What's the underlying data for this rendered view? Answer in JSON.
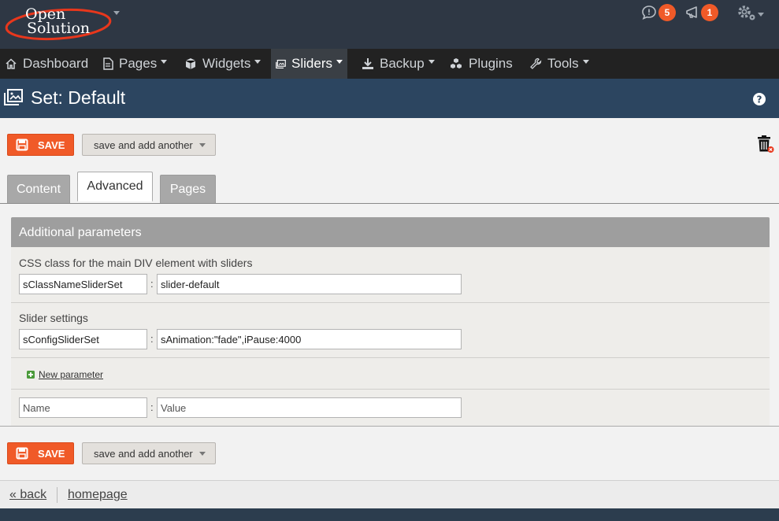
{
  "brand": {
    "logo_line1": "Open",
    "logo_line2": "Solution",
    "logo_swoosh_color": "#e8371c"
  },
  "header": {
    "notifications": [
      {
        "icon": "comment-icon",
        "count": "5"
      },
      {
        "icon": "megaphone-icon",
        "count": "1"
      }
    ],
    "settings_icon": "gear-icon",
    "badge_color": "#f05a28"
  },
  "nav": {
    "items": [
      {
        "label": "Dashboard",
        "icon": "home-icon",
        "dropdown": false,
        "active": false
      },
      {
        "label": "Pages",
        "icon": "document-icon",
        "dropdown": true,
        "active": false
      },
      {
        "label": "Widgets",
        "icon": "cube-icon",
        "dropdown": true,
        "active": false
      },
      {
        "label": "Sliders",
        "icon": "image-icon",
        "dropdown": true,
        "active": true
      },
      {
        "label": "Backup",
        "icon": "download-icon",
        "dropdown": true,
        "active": false
      },
      {
        "label": "Plugins",
        "icon": "cubes-icon",
        "dropdown": false,
        "active": false
      },
      {
        "label": "Tools",
        "icon": "wrench-icon",
        "dropdown": true,
        "active": false
      }
    ]
  },
  "page": {
    "title": "Set: Default",
    "title_icon": "image-icon",
    "help_icon": "question-circle-icon"
  },
  "actions": {
    "save_label": "SAVE",
    "save_another_label": "save and add another",
    "delete_icon": "trash-icon"
  },
  "tabs": [
    {
      "label": "Content",
      "active": false
    },
    {
      "label": "Advanced",
      "active": true
    },
    {
      "label": "Pages",
      "active": false
    }
  ],
  "panel": {
    "heading": "Additional parameters",
    "params": [
      {
        "label": "CSS class for the main DIV element with sliders",
        "name": "sClassNameSliderSet",
        "value": "slider-default"
      },
      {
        "label": "Slider settings",
        "name": "sConfigSliderSet",
        "value": "sAnimation:\"fade\",iPause:4000"
      }
    ],
    "separator": ":",
    "new_parameter_label": "New parameter",
    "new_param": {
      "name_placeholder": "Name",
      "value_placeholder": "Value"
    }
  },
  "footer": {
    "back_label": "« back",
    "homepage_label": "homepage"
  },
  "colors": {
    "header_bg": "#2e3744",
    "nav_bg": "#222222",
    "title_bg": "#2c4560",
    "accent": "#f05a28"
  }
}
